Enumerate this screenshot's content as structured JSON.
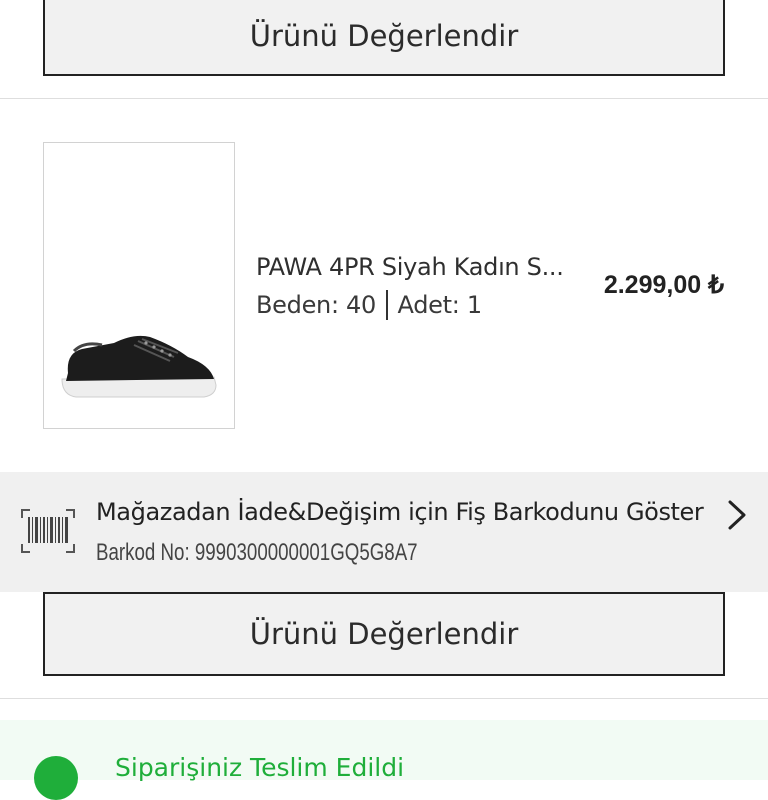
{
  "buttons": {
    "rate_top": "Ürünü Değerlendir",
    "rate_bottom": "Ürünü Değerlendir"
  },
  "product": {
    "name": "PAWA 4PR Siyah Kadın S...",
    "size_text": "Beden: 40",
    "quantity_text": "Adet: 1",
    "price": "2.299,00 ₺",
    "image_icon": "black-sneaker-image"
  },
  "barcode": {
    "title": "Mağazadan İade&Değişim için Fiş Barkodunu Göster",
    "number_text": "Barkod No: 9990300000001GQ5G8A7",
    "icon": "barcode-scan-icon",
    "action_icon": "chevron-right-icon"
  },
  "status": {
    "text": "Siparişiniz Teslim Edildi",
    "color": "#1fae3a"
  }
}
